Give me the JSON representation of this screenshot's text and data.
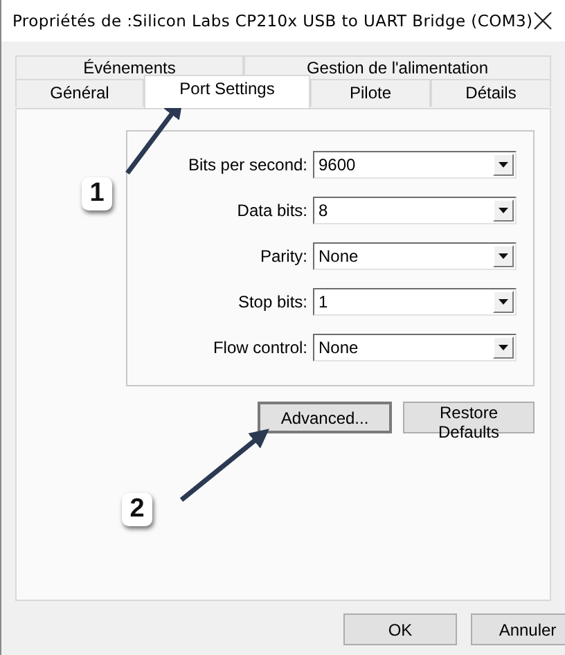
{
  "window": {
    "title": "Propriétés de :Silicon Labs CP210x USB to UART Bridge (COM3)"
  },
  "tab_rows": [
    [
      {
        "label": "Événements",
        "selected": false
      },
      {
        "label": "Gestion de l'alimentation",
        "selected": false
      }
    ],
    [
      {
        "label": "Général",
        "selected": false
      },
      {
        "label": "Port Settings",
        "selected": true
      },
      {
        "label": "Pilote",
        "selected": false
      },
      {
        "label": "Détails",
        "selected": false
      }
    ]
  ],
  "fields": [
    {
      "label": "Bits per second:",
      "value": "9600"
    },
    {
      "label": "Data bits:",
      "value": "8"
    },
    {
      "label": "Parity:",
      "value": "None"
    },
    {
      "label": "Stop bits:",
      "value": "1"
    },
    {
      "label": "Flow control:",
      "value": "None"
    }
  ],
  "panel_buttons": [
    "Advanced...",
    "Restore Defaults"
  ],
  "annotations": [
    {
      "number": "1"
    },
    {
      "number": "2"
    }
  ],
  "dialog_buttons": [
    "OK",
    "Annuler"
  ]
}
